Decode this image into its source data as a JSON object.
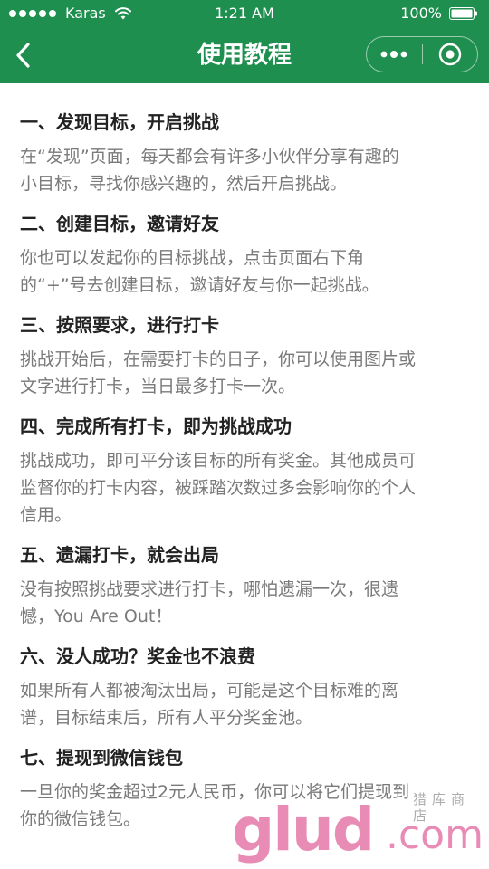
{
  "status_bar": {
    "carrier": "Karas",
    "time": "1:21 AM",
    "battery": "100%"
  },
  "nav": {
    "title": "使用教程",
    "back_icon": "chevron-left-icon",
    "more_icon": "more-dots-icon",
    "close_icon": "close-circle-icon"
  },
  "colors": {
    "header_bg": "#1f8f4f",
    "title_text": "#222222",
    "body_text": "#7a7a7a"
  },
  "sections": [
    {
      "title": "一、发现目标，开启挑战",
      "lines": [
        "在“发现”页面，每天都会有许多小伙伴分享有趣的",
        "小目标，寻找你感兴趣的，然后开启挑战。"
      ]
    },
    {
      "title": "二、创建目标，邀请好友",
      "lines": [
        "你也可以发起你的目标挑战，点击页面右下角",
        "的“+”号去创建目标，邀请好友与你一起挑战。"
      ]
    },
    {
      "title": "三、按照要求，进行打卡",
      "lines": [
        "挑战开始后，在需要打卡的日子，你可以使用图片或",
        "文字进行打卡，当日最多打卡一次。"
      ]
    },
    {
      "title": "四、完成所有打卡，即为挑战成功",
      "lines": [
        "挑战成功，即可平分该目标的所有奖金。其他成员可",
        "监督你的打卡内容，被踩踏次数过多会影响你的个人",
        "信用。"
      ]
    },
    {
      "title": "五、遗漏打卡，就会出局",
      "lines": [
        "没有按照挑战要求进行打卡，哪怕遗漏一次，很遗",
        "憾，You Are Out！"
      ]
    },
    {
      "title": "六、没人成功？奖金也不浪费",
      "lines": [
        "如果所有人都被淘汰出局，可能是这个目标难的离",
        "谱，目标结束后，所有人平分奖金池。"
      ]
    },
    {
      "title": "七、提现到微信钱包",
      "lines": [
        "一旦你的奖金超过2元人民币，你可以将它们提现到",
        "你的微信钱包。"
      ]
    }
  ],
  "watermark": {
    "main": "glud",
    "suffix": ".com",
    "script": "猎库商店"
  }
}
